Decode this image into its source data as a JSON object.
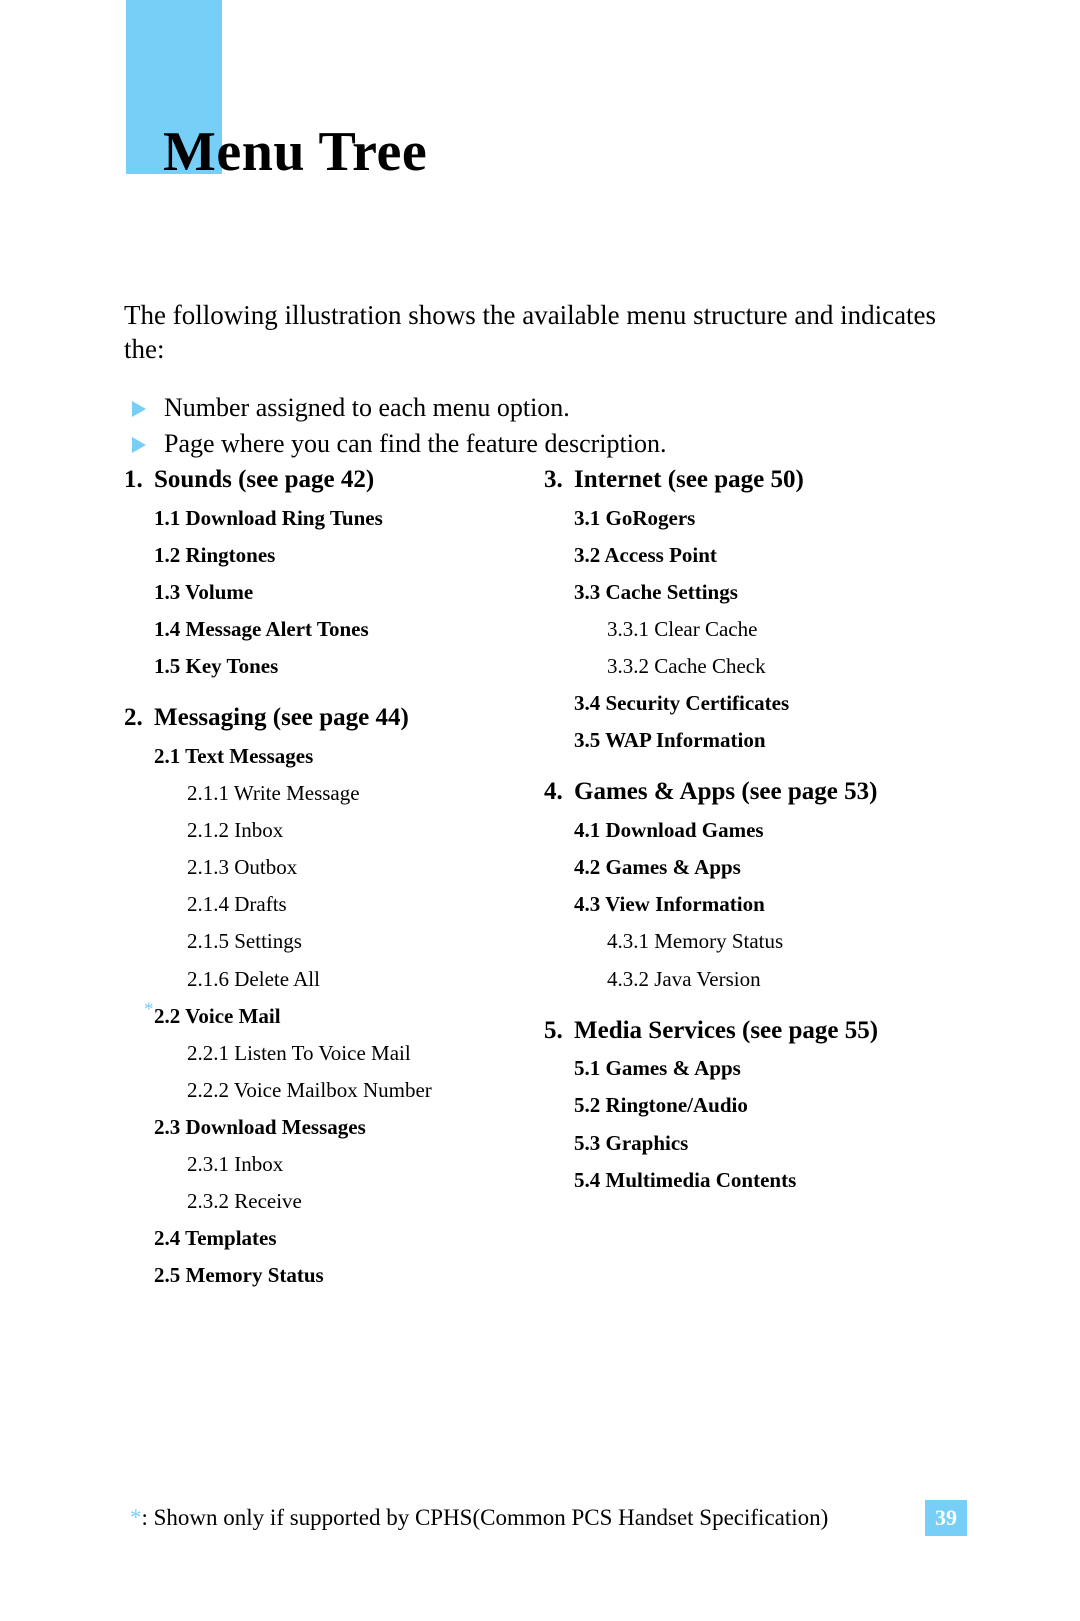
{
  "header": {
    "title": "Menu Tree",
    "accent_color": "#77cff7"
  },
  "intro": {
    "paragraph": "The following illustration shows the available menu structure and indicates the:",
    "bullets": [
      "Number assigned to each menu option.",
      "Page where you can find the feature description."
    ]
  },
  "tree": {
    "left_column": [
      {
        "number": "1.",
        "title": "Sounds (see page 42)",
        "items": [
          {
            "level": 2,
            "label": "1.1 Download Ring Tunes"
          },
          {
            "level": 2,
            "label": "1.2 Ringtones"
          },
          {
            "level": 2,
            "label": "1.3 Volume"
          },
          {
            "level": 2,
            "label": "1.4 Message Alert Tones"
          },
          {
            "level": 2,
            "label": "1.5 Key Tones"
          }
        ]
      },
      {
        "number": "2.",
        "title": "Messaging (see page 44)",
        "items": [
          {
            "level": 2,
            "label": "2.1 Text Messages"
          },
          {
            "level": 3,
            "label": "2.1.1 Write Message"
          },
          {
            "level": 3,
            "label": "2.1.2 Inbox"
          },
          {
            "level": 3,
            "label": "2.1.3 Outbox"
          },
          {
            "level": 3,
            "label": "2.1.4 Drafts"
          },
          {
            "level": 3,
            "label": "2.1.5 Settings"
          },
          {
            "level": 3,
            "label": "2.1.6 Delete All"
          },
          {
            "level": 2,
            "label": "2.2 Voice Mail",
            "footnote_marker": "*"
          },
          {
            "level": 3,
            "label": "2.2.1 Listen To Voice Mail"
          },
          {
            "level": 3,
            "label": "2.2.2 Voice Mailbox Number"
          },
          {
            "level": 2,
            "label": "2.3 Download Messages"
          },
          {
            "level": 3,
            "label": "2.3.1 Inbox"
          },
          {
            "level": 3,
            "label": "2.3.2 Receive"
          },
          {
            "level": 2,
            "label": "2.4 Templates"
          },
          {
            "level": 2,
            "label": "2.5 Memory Status"
          }
        ]
      }
    ],
    "right_column": [
      {
        "number": "3.",
        "title": "Internet (see page 50)",
        "items": [
          {
            "level": 2,
            "label": "3.1 GoRogers"
          },
          {
            "level": 2,
            "label": "3.2 Access Point"
          },
          {
            "level": 2,
            "label": "3.3 Cache Settings"
          },
          {
            "level": 3,
            "label": "3.3.1 Clear Cache"
          },
          {
            "level": 3,
            "label": "3.3.2 Cache Check"
          },
          {
            "level": 2,
            "label": "3.4 Security Certificates"
          },
          {
            "level": 2,
            "label": "3.5 WAP Information"
          }
        ]
      },
      {
        "number": "4.",
        "title": "Games & Apps (see page 53)",
        "items": [
          {
            "level": 2,
            "label": "4.1 Download Games"
          },
          {
            "level": 2,
            "label": "4.2 Games & Apps"
          },
          {
            "level": 2,
            "label": "4.3 View Information"
          },
          {
            "level": 3,
            "label": "4.3.1 Memory Status"
          },
          {
            "level": 3,
            "label": "4.3.2 Java Version"
          }
        ]
      },
      {
        "number": "5.",
        "title": "Media Services (see page 55)",
        "items": [
          {
            "level": 2,
            "label": "5.1 Games & Apps"
          },
          {
            "level": 2,
            "label": "5.2 Ringtone/Audio"
          },
          {
            "level": 2,
            "label": "5.3 Graphics"
          },
          {
            "level": 2,
            "label": "5.4 Multimedia Contents"
          }
        ]
      }
    ]
  },
  "footer": {
    "footnote_marker": "*",
    "footnote_text": ": Shown only if supported by CPHS(Common PCS Handset Specification)",
    "page_number": "39"
  }
}
